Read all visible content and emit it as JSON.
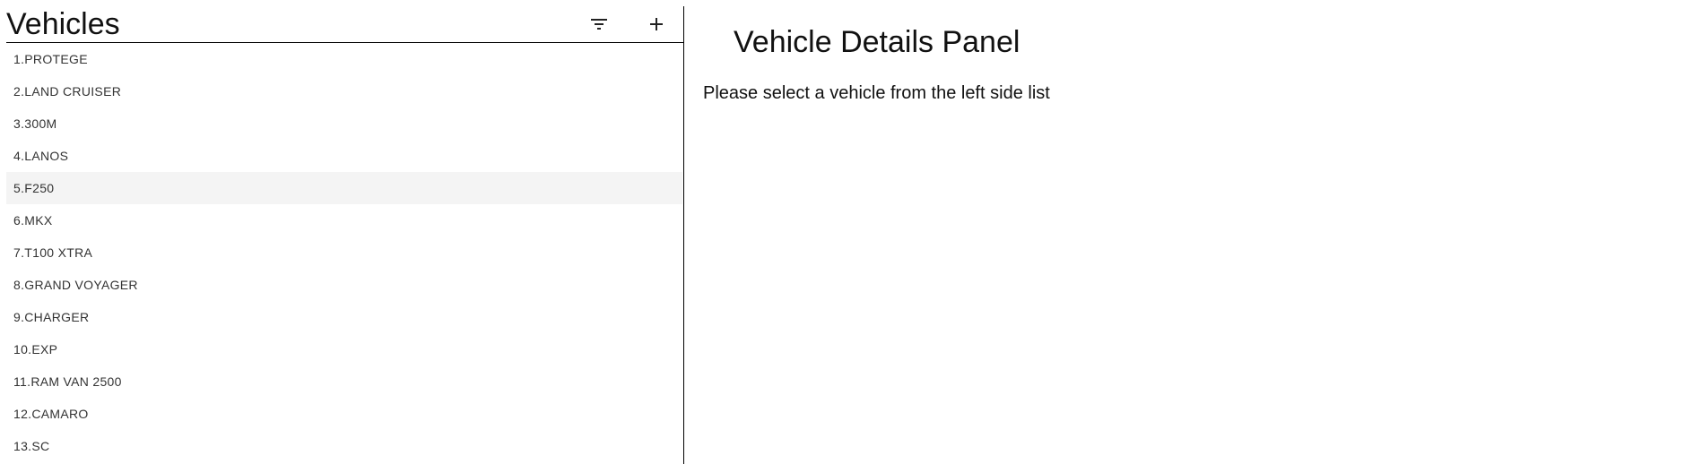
{
  "sidebar": {
    "title": "Vehicles",
    "filter_icon": "filter-icon",
    "add_icon": "plus-icon",
    "items": [
      {
        "label": "1.PROTEGE"
      },
      {
        "label": "2.LAND CRUISER"
      },
      {
        "label": "3.300M"
      },
      {
        "label": "4.LANOS"
      },
      {
        "label": "5.F250"
      },
      {
        "label": "6.MKX"
      },
      {
        "label": "7.T100 XTRA"
      },
      {
        "label": "8.GRAND VOYAGER"
      },
      {
        "label": "9.CHARGER"
      },
      {
        "label": "10.EXP"
      },
      {
        "label": "11.RAM VAN 2500"
      },
      {
        "label": "12.CAMARO"
      },
      {
        "label": "13.SC"
      }
    ],
    "hovered_item_index": 4
  },
  "details": {
    "title": "Vehicle Details Panel",
    "message": "Please select a vehicle from the left side list"
  },
  "colors": {
    "hover_background": "#f4f4f4",
    "divider": "#000000",
    "item_text": "#333333"
  }
}
